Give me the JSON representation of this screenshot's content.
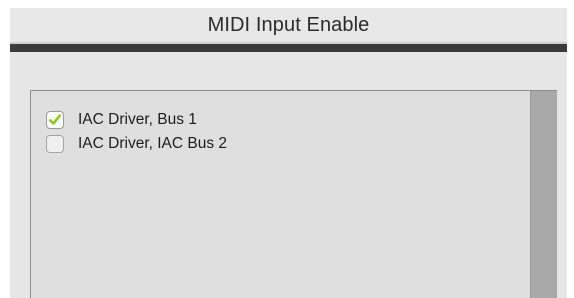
{
  "window": {
    "title": "MIDI Input Enable"
  },
  "midi_inputs": [
    {
      "label": "IAC Driver, Bus 1",
      "checked": true
    },
    {
      "label": "IAC Driver, IAC Bus 2",
      "checked": false
    }
  ],
  "colors": {
    "check_accent": "#8fc91d",
    "separator": "#3b3b3b",
    "list_background": "#dfdfdf",
    "scrollbar": "#a9a9a9"
  },
  "icons": {
    "checked": "check-icon"
  }
}
